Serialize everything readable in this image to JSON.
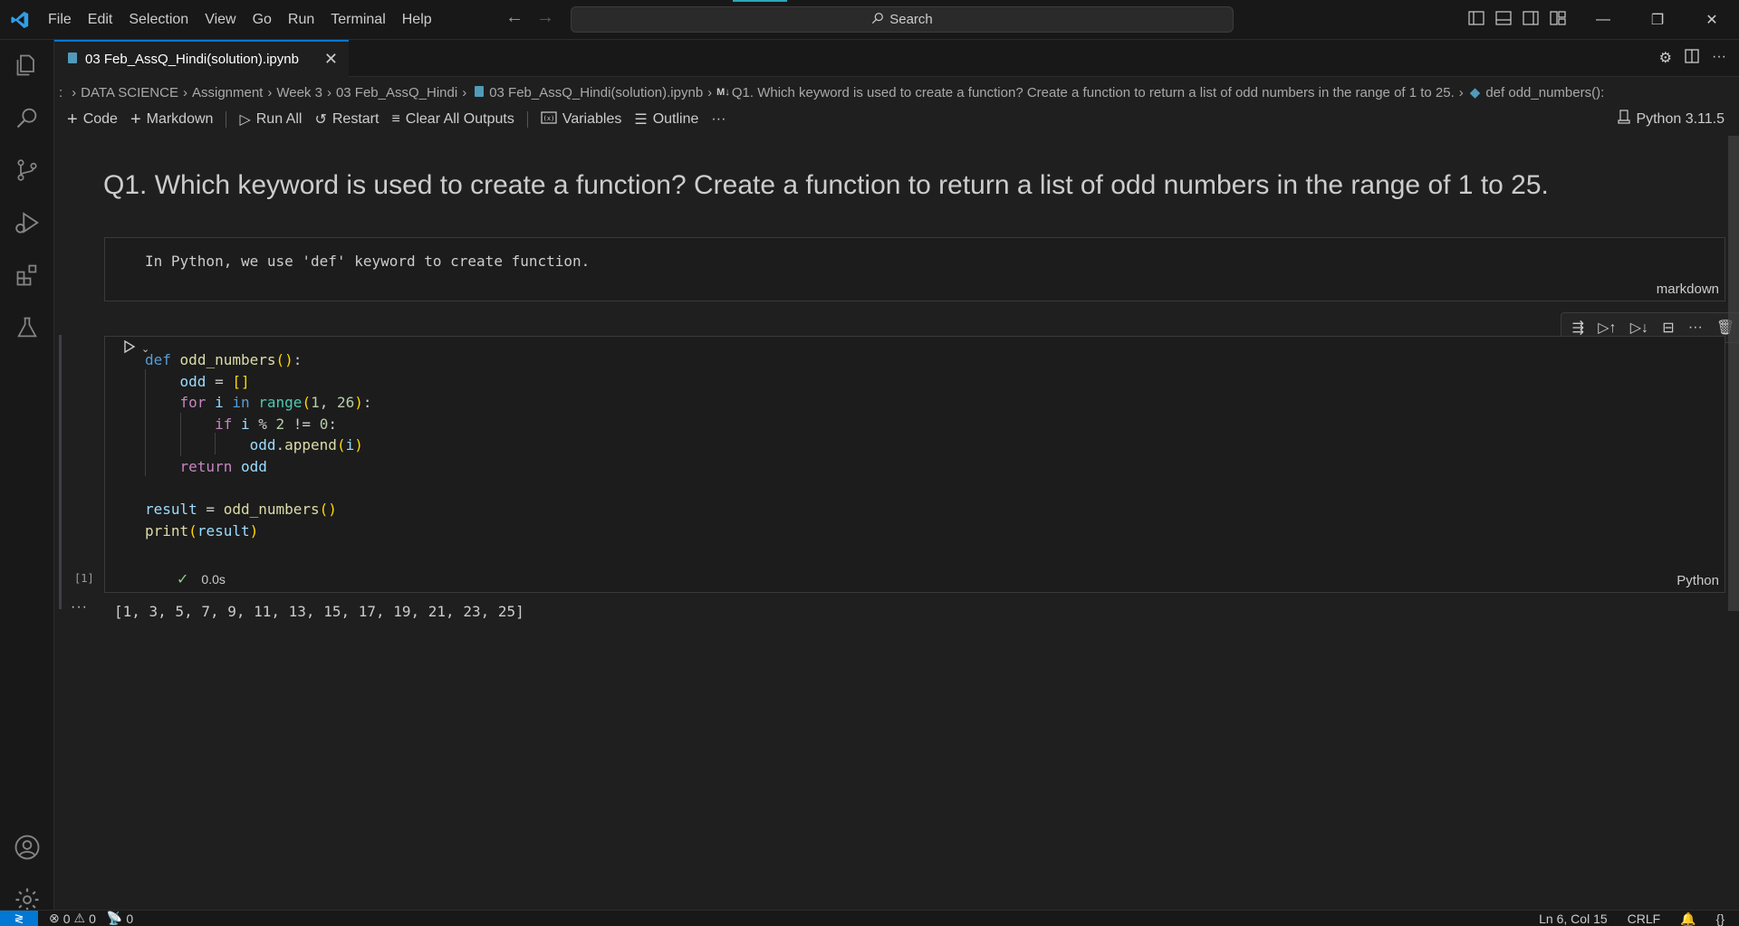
{
  "app": {
    "menu": [
      "File",
      "Edit",
      "Selection",
      "View",
      "Go",
      "Run",
      "Terminal",
      "Help"
    ],
    "search_placeholder": "Search"
  },
  "tab": {
    "title": "03 Feb_AssQ_Hindi(solution).ipynb"
  },
  "breadcrumb": {
    "items": [
      "DATA SCIENCE",
      "Assignment",
      "Week 3",
      "03 Feb_AssQ_Hindi",
      "03 Feb_AssQ_Hindi(solution).ipynb",
      "Q1. Which keyword is used to create a function? Create a function to return a list of odd numbers in the range of 1 to 25.",
      "def odd_numbers():"
    ],
    "md_prefix": "M↓"
  },
  "toolbar": {
    "code": "Code",
    "markdown": "Markdown",
    "run_all": "Run All",
    "restart": "Restart",
    "clear_outputs": "Clear All Outputs",
    "variables": "Variables",
    "outline": "Outline",
    "kernel": "Python 3.11.5"
  },
  "cells": {
    "heading": "Q1. Which keyword is used to create a function? Create a function to return a list of odd numbers in the range of 1 to 25.",
    "markdown_text": "In Python, we use 'def' keyword to create function.",
    "markdown_lang": "markdown",
    "exec_count": "[1]",
    "exec_time": "0.0s",
    "code_lang": "Python",
    "output": "[1, 3, 5, 7, 9, 11, 13, 15, 17, 19, 21, 23, 25]"
  },
  "statusbar": {
    "errors": "0",
    "warnings": "0",
    "ports": "0",
    "position": "Ln 6, Col 15",
    "eol": "CRLF"
  },
  "colors": {
    "accent": "#0078d4",
    "background": "#1f1f1f"
  }
}
